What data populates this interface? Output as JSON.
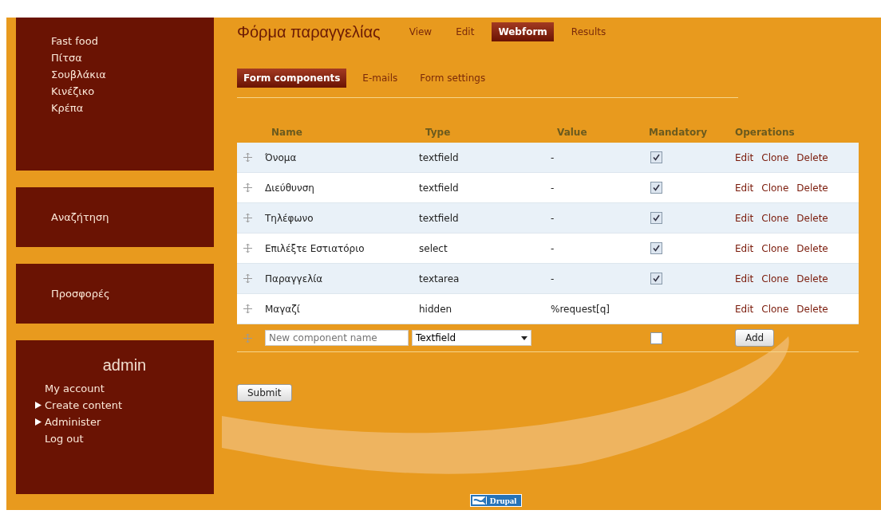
{
  "sidebar": {
    "blocks": [
      {
        "kind": "menu",
        "items": [
          "Fast food",
          "Πίτσα",
          "Σουβλάκια",
          "Κινέζικο",
          "Κρέπα"
        ]
      },
      {
        "kind": "single",
        "items": [
          "Αναζήτηση"
        ]
      },
      {
        "kind": "single",
        "items": [
          "Προσφορές"
        ]
      },
      {
        "kind": "user",
        "title": "admin",
        "links": [
          {
            "label": "My account",
            "expandable": false
          },
          {
            "label": "Create content",
            "expandable": true
          },
          {
            "label": "Administer",
            "expandable": true
          },
          {
            "label": "Log out",
            "expandable": false
          }
        ]
      }
    ]
  },
  "page_title": "Φόρμα παραγγελίας",
  "tabs": [
    {
      "label": "View",
      "selected": false
    },
    {
      "label": "Edit",
      "selected": false
    },
    {
      "label": "Webform",
      "selected": true
    },
    {
      "label": "Results",
      "selected": false
    }
  ],
  "subtabs": [
    {
      "label": "Form components",
      "selected": true
    },
    {
      "label": "E-mails",
      "selected": false
    },
    {
      "label": "Form settings",
      "selected": false
    }
  ],
  "table": {
    "columns": [
      "Name",
      "Type",
      "Value",
      "Mandatory",
      "Operations"
    ],
    "rows": [
      {
        "name": "Όνομα",
        "type": "textfield",
        "value": "-",
        "mandatory": true,
        "operations": [
          "Edit",
          "Clone",
          "Delete"
        ]
      },
      {
        "name": "Διεύθυνση",
        "type": "textfield",
        "value": "-",
        "mandatory": true,
        "operations": [
          "Edit",
          "Clone",
          "Delete"
        ]
      },
      {
        "name": "Τηλέφωνο",
        "type": "textfield",
        "value": "-",
        "mandatory": true,
        "operations": [
          "Edit",
          "Clone",
          "Delete"
        ]
      },
      {
        "name": "Επιλέξτε Εστιατόριο",
        "type": "select",
        "value": "-",
        "mandatory": true,
        "operations": [
          "Edit",
          "Clone",
          "Delete"
        ]
      },
      {
        "name": "Παραγγελία",
        "type": "textarea",
        "value": "-",
        "mandatory": true,
        "operations": [
          "Edit",
          "Clone",
          "Delete"
        ]
      },
      {
        "name": "Μαγαζί",
        "type": "hidden",
        "value": "%request[q]",
        "operations": [
          "Edit",
          "Clone",
          "Delete"
        ]
      }
    ],
    "new_row": {
      "placeholder": "New component name",
      "type": "Textfield",
      "mandatory": false,
      "add_button": "Add"
    }
  },
  "submit_button": "Submit",
  "footer_badge": "Drupal"
}
